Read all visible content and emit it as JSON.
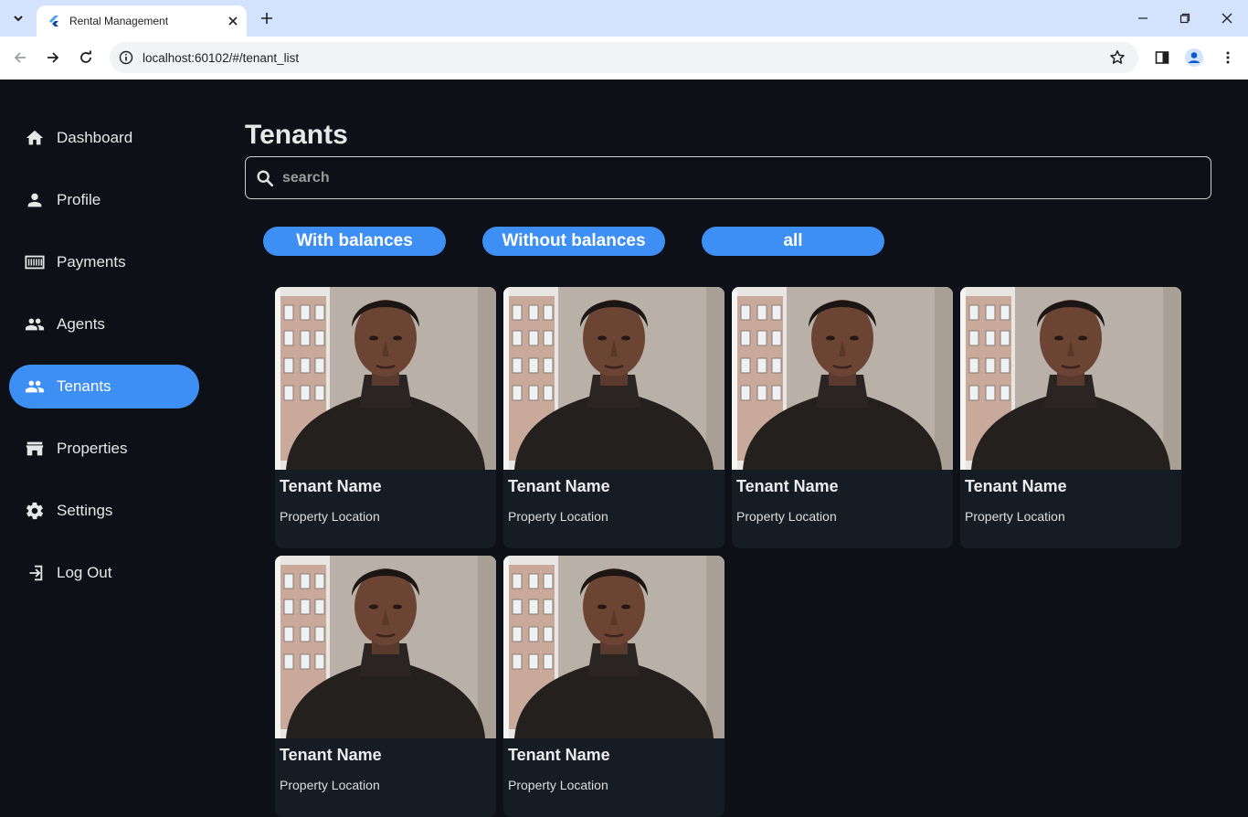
{
  "browser": {
    "tab_title": "Rental Management",
    "url": "localhost:60102/#/tenant_list"
  },
  "sidebar": {
    "items": [
      {
        "label": "Dashboard",
        "icon": "home-icon",
        "active": false
      },
      {
        "label": "Profile",
        "icon": "person-icon",
        "active": false
      },
      {
        "label": "Payments",
        "icon": "payments-icon",
        "active": false
      },
      {
        "label": "Agents",
        "icon": "people-icon",
        "active": false
      },
      {
        "label": "Tenants",
        "icon": "people-icon",
        "active": true
      },
      {
        "label": "Properties",
        "icon": "storefront-icon",
        "active": false
      },
      {
        "label": "Settings",
        "icon": "gear-icon",
        "active": false
      },
      {
        "label": "Log Out",
        "icon": "logout-icon",
        "active": false
      }
    ]
  },
  "main": {
    "title": "Tenants",
    "search": {
      "placeholder": "search",
      "value": ""
    },
    "filters": [
      "With balances",
      "Without balances",
      "all"
    ],
    "tenants": [
      {
        "name": "Tenant Name",
        "location": "Property Location"
      },
      {
        "name": "Tenant Name",
        "location": "Property Location"
      },
      {
        "name": "Tenant Name",
        "location": "Property Location"
      },
      {
        "name": "Tenant Name",
        "location": "Property Location"
      },
      {
        "name": "Tenant Name",
        "location": "Property Location"
      },
      {
        "name": "Tenant Name",
        "location": "Property Location"
      }
    ]
  },
  "colors": {
    "background": "#0d1117",
    "accent": "#3d8ff4",
    "card": "#161c23"
  }
}
